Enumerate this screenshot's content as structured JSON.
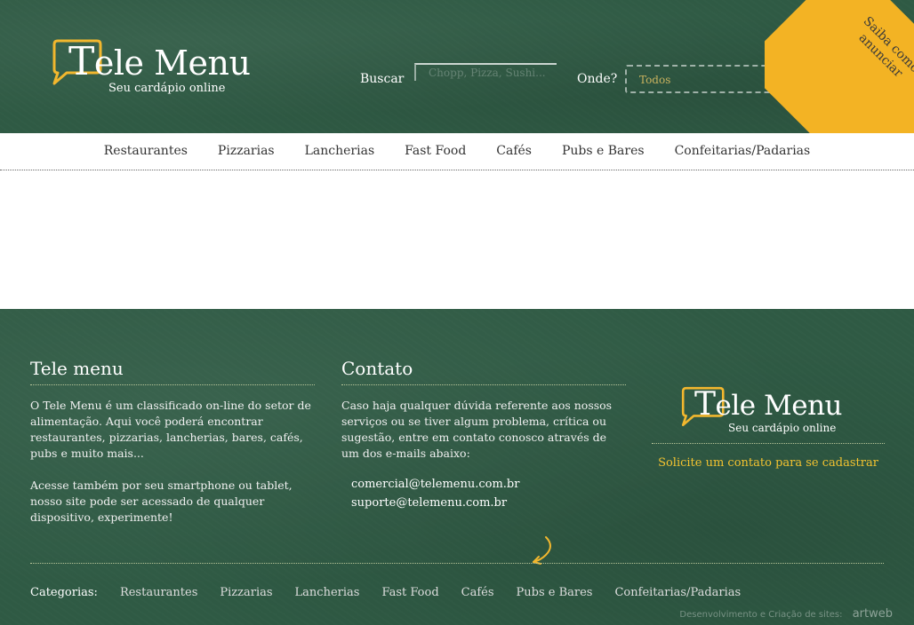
{
  "header": {
    "logo": {
      "brand_initial": "T",
      "brand_rest": "ele Menu",
      "tagline": "Seu cardápio online"
    },
    "search": {
      "label": "Buscar",
      "placeholder": "Chopp, Pizza, Sushi..."
    },
    "where": {
      "label": "Onde?",
      "selected": "Todos"
    },
    "go_icon": "magnifier-icon",
    "ribbon_text": "Saiba como anunciar"
  },
  "nav": {
    "items": [
      "Restaurantes",
      "Pizzarias",
      "Lancherias",
      "Fast Food",
      "Cafés",
      "Pubs e Bares",
      "Confeitarias/Padarias"
    ]
  },
  "footer": {
    "about": {
      "title": "Tele menu",
      "p1": "O Tele Menu é um classificado on-line do setor de alimentação. Aqui você poderá encontrar restaurantes, pizzarias, lancherias, bares, cafés, pubs e muito mais...",
      "p2": "Acesse também por seu smartphone ou tablet, nosso site pode ser acessado de qualquer dispositivo, experimente!"
    },
    "contact": {
      "title": "Contato",
      "p1": "Caso haja qualquer dúvida referente aos nossos serviços ou se tiver algum problema, crítica ou sugestão, entre em contato conosco através de um dos e-mails abaixo:",
      "emails": [
        "comercial@telemenu.com.br",
        "suporte@telemenu.com.br"
      ]
    },
    "brand": {
      "logo": {
        "brand_initial": "T",
        "brand_rest": "ele Menu",
        "tagline": "Seu cardápio online"
      },
      "cta": "Solicite um contato para se cadastrar"
    },
    "categories_label": "Categorias:",
    "categories": [
      "Restaurantes",
      "Pizzarias",
      "Lancherias",
      "Fast Food",
      "Cafés",
      "Pubs e Bares",
      "Confeitarias/Padarias"
    ],
    "credit": {
      "text": "Desenvolvimento e Criação de sites:",
      "brand": "artweb"
    }
  },
  "colors": {
    "board": "#2f5a44",
    "accent": "#f2b72e",
    "cta": "#f2c230"
  }
}
